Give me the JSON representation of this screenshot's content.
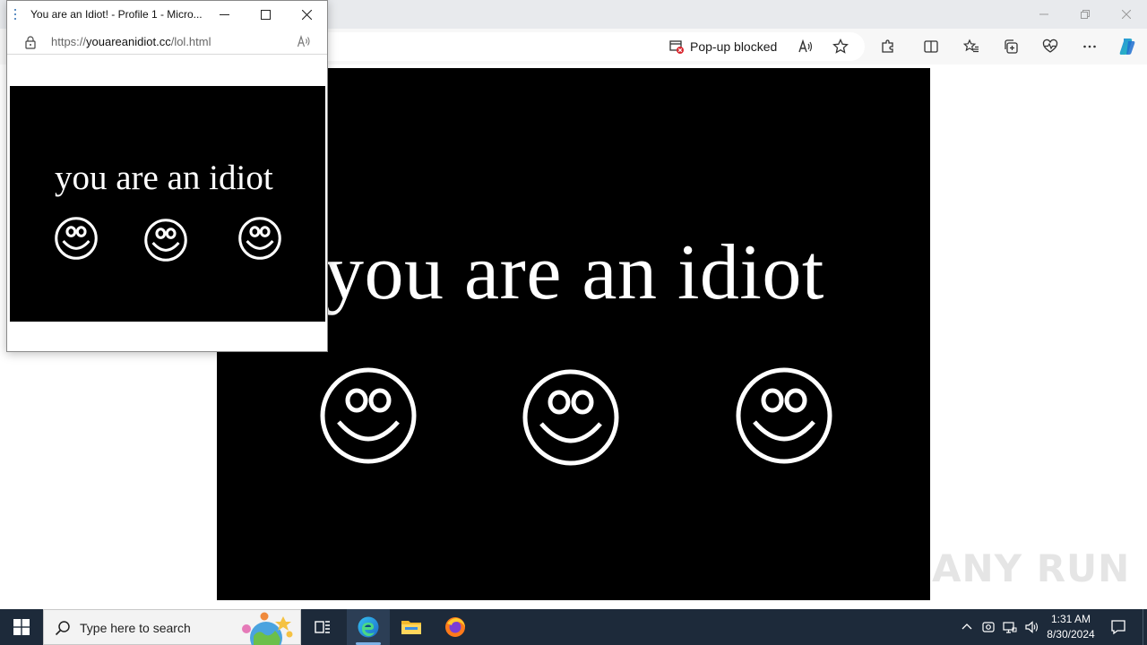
{
  "main_window": {
    "popup_blocked_label": "Pop-up blocked",
    "page": {
      "headline": "you are an idiot"
    }
  },
  "popup_window": {
    "title": "You are an Idiot! - Profile 1 - Micro...",
    "url_prefix": "https://",
    "url_domain": "youareanidiot.cc",
    "url_path": "/lol.html",
    "page": {
      "headline": "you are an idiot"
    }
  },
  "taskbar": {
    "search_placeholder": "Type here to search",
    "clock_time": "1:31 AM",
    "clock_date": "8/30/2024"
  },
  "watermark": "ANY RUN",
  "colors": {
    "page_background": "#000000",
    "headline_color": "#ffffff",
    "taskbar": "#1d2a3a",
    "copilot_accent": "#2b8ee0"
  }
}
